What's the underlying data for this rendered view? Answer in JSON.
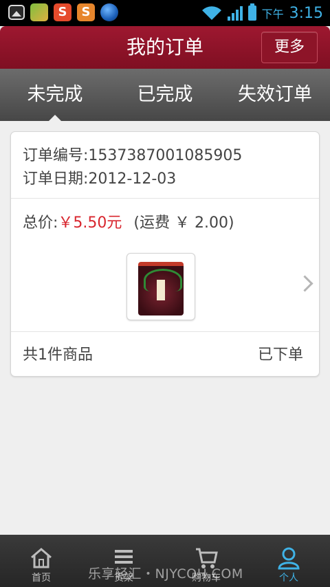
{
  "status_bar": {
    "time_prefix": "下午",
    "time": "3:15",
    "left_icons": [
      "gallery-icon",
      "app-icon",
      "weibo-s-icon",
      "s-app-icon",
      "globe-icon"
    ],
    "app2_glyph": "S",
    "app3_glyph": "S"
  },
  "header": {
    "title": "我的订单",
    "more_label": "更多"
  },
  "tabs": [
    {
      "label": "未完成",
      "active": true
    },
    {
      "label": "已完成",
      "active": false
    },
    {
      "label": "失效订单",
      "active": false
    }
  ],
  "order": {
    "number_label": "订单编号:",
    "number": "1537387001085905",
    "date_label": "订单日期:",
    "date": "2012-12-03",
    "total_label": "总价:",
    "total_price": "￥5.50元",
    "shipping_text": "(运费 ￥ 2.00)",
    "item_count": "共1件商品",
    "status": "已下单"
  },
  "nav": [
    {
      "label": "首页",
      "icon": "home-icon",
      "active": false
    },
    {
      "label": "货架",
      "icon": "shelf-list-icon",
      "active": false
    },
    {
      "label": "购物车",
      "icon": "cart-icon",
      "active": false
    },
    {
      "label": "个人",
      "icon": "person-icon",
      "active": true
    }
  ],
  "watermark": "乐享轻汇・NJYCOH.COM",
  "colors": {
    "brand": "#8d1428",
    "accent": "#3fb2e6",
    "price": "#d8262e"
  }
}
